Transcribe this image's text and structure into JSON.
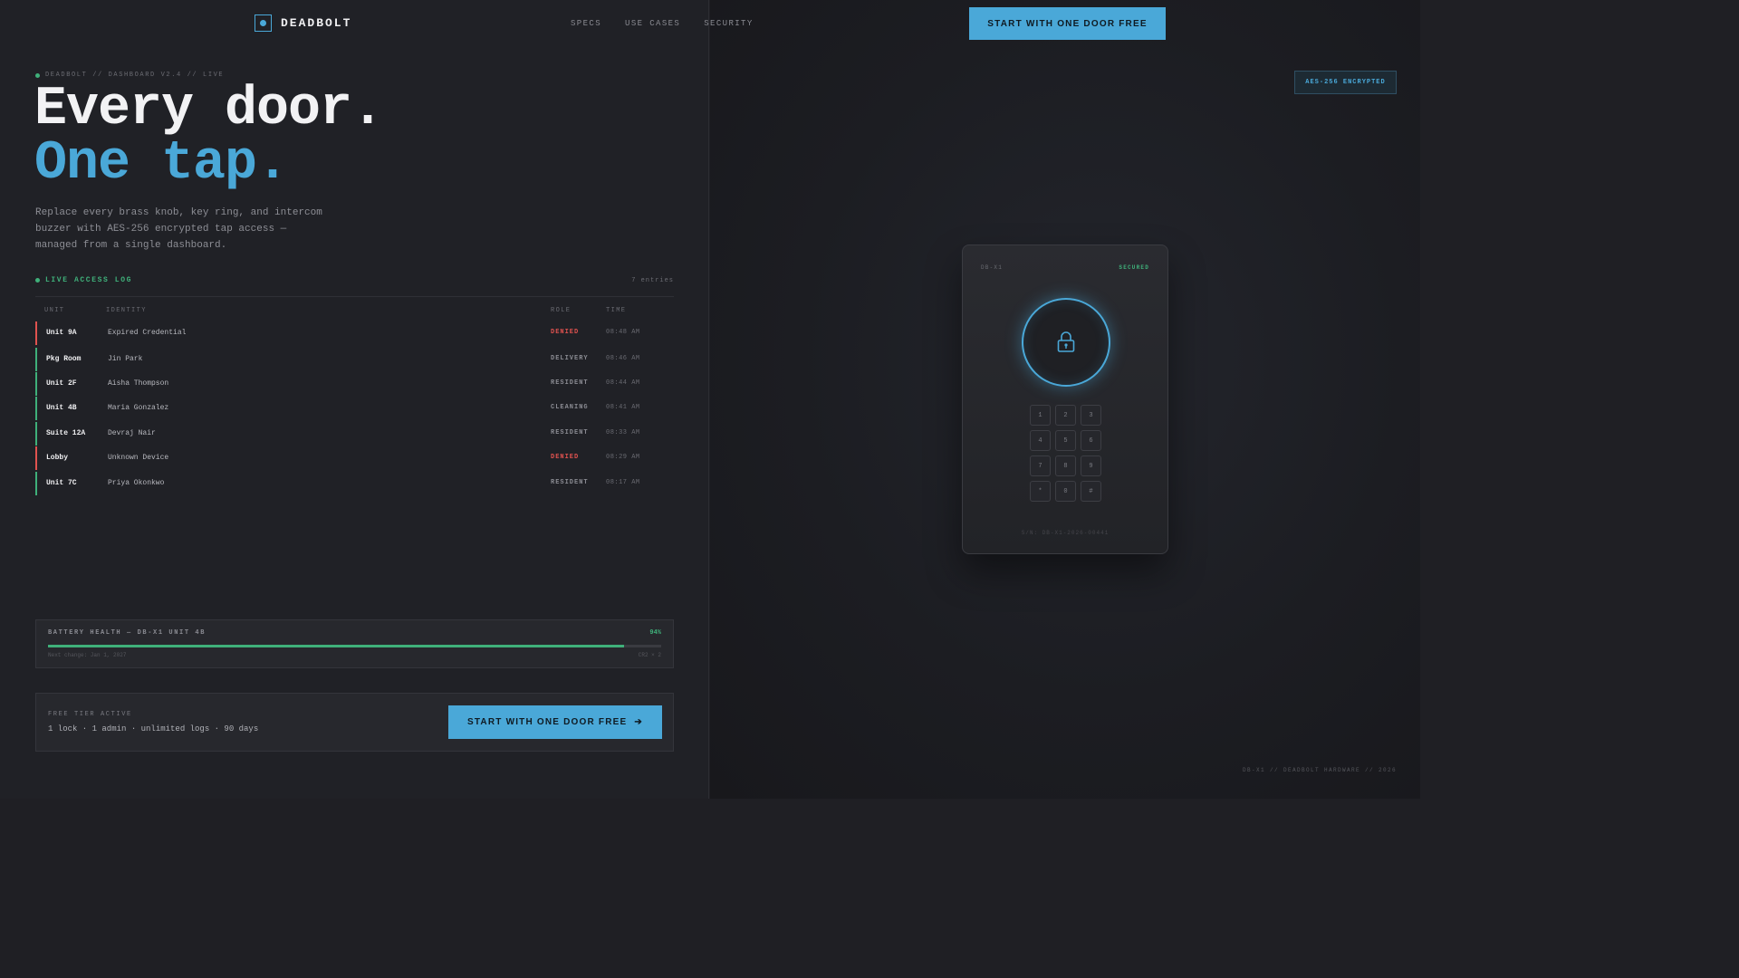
{
  "brand": {
    "name": "DEADBOLT"
  },
  "nav": {
    "items": [
      "SPECS",
      "USE CASES",
      "SECURITY"
    ]
  },
  "header": {
    "cta_label": "START WITH ONE DOOR FREE"
  },
  "hero": {
    "breadcrumb": "DEADBOLT // DASHBOARD V2.4 // LIVE",
    "title_line1": "Every door.",
    "title_line2": "One tap.",
    "lede": "Replace every brass knob, key ring, and intercom buzzer with AES-256 encrypted tap access — managed from a single dashboard."
  },
  "access_log": {
    "title": "LIVE ACCESS LOG",
    "count": "7 entries",
    "columns": [
      "UNIT",
      "IDENTITY",
      "ROLE",
      "TIME"
    ],
    "rows": [
      {
        "unit": "Unit 9A",
        "identity": "Expired Credential",
        "role": "DENIED",
        "time": "08:48 AM",
        "status": "denied"
      },
      {
        "unit": "Pkg Room",
        "identity": "Jin Park",
        "role": "DELIVERY",
        "time": "08:46 AM",
        "status": "ok"
      },
      {
        "unit": "Unit 2F",
        "identity": "Aisha Thompson",
        "role": "RESIDENT",
        "time": "08:44 AM",
        "status": "ok"
      },
      {
        "unit": "Unit 4B",
        "identity": "Maria Gonzalez",
        "role": "CLEANING",
        "time": "08:41 AM",
        "status": "ok"
      },
      {
        "unit": "Suite 12A",
        "identity": "Devraj Nair",
        "role": "RESIDENT",
        "time": "08:33 AM",
        "status": "ok"
      },
      {
        "unit": "Lobby",
        "identity": "Unknown Device",
        "role": "DENIED",
        "time": "08:29 AM",
        "status": "denied"
      },
      {
        "unit": "Unit 7C",
        "identity": "Priya Okonkwo",
        "role": "RESIDENT",
        "time": "08:17 AM",
        "status": "ok"
      }
    ]
  },
  "battery": {
    "title": "BATTERY HEALTH — DB-X1 UNIT 4B",
    "percent_label": "94%",
    "percent": 94,
    "last_change": "Next change: Jan 1, 2027",
    "cells": "CR2 × 2"
  },
  "free_tier": {
    "label": "FREE TIER ACTIVE",
    "description": "1 lock · 1 admin · unlimited logs · 90 days",
    "cta_label": "START WITH ONE DOOR FREE",
    "cta_arrow": "➔"
  },
  "device": {
    "badge": "AES-256 ENCRYPTED",
    "model": "DB-X1",
    "status": "SECURED",
    "keys": [
      "1",
      "2",
      "3",
      "4",
      "5",
      "6",
      "7",
      "8",
      "9",
      "*",
      "0",
      "#"
    ],
    "serial": "S/N: DB-X1-2026-00441",
    "footer": "DB-X1 // DEADBOLT HARDWARE // 2026"
  },
  "colors": {
    "accent": "#4aa8d8",
    "ok": "#3fb07a",
    "denied": "#e0524f",
    "background": "#202126"
  }
}
